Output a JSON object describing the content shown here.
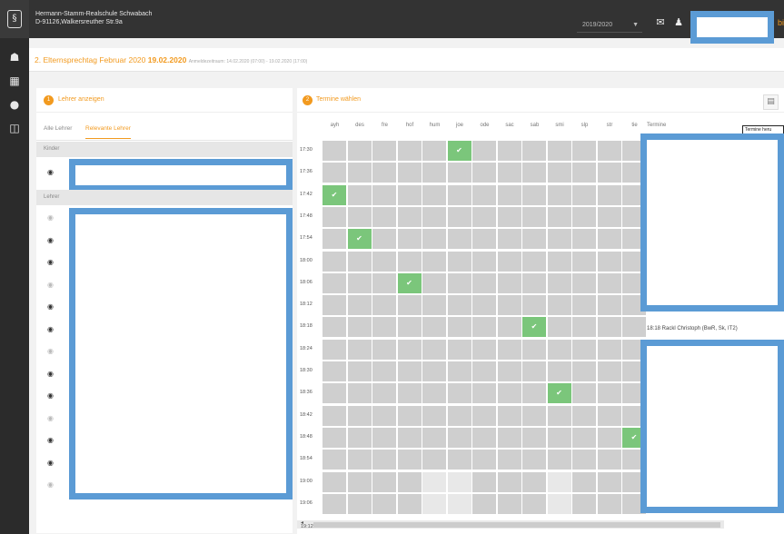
{
  "app": {
    "school_name": "Hermann-Stamm-Realschule Schwabach",
    "school_address": "D-91126,Walkersreuther Str.9a",
    "school_year": "2019/2020",
    "edge_mark": "bi"
  },
  "event": {
    "title_prefix": "2. Elternsprechtag Februar 2020",
    "title_date": "19.02.2020",
    "anmeldung": "Anmeldezeitraum: 14.02.2020 (07:00) - 19.02.2020 (17:00)"
  },
  "icons": {
    "logo": "school-logo",
    "sidebar": [
      "dashboard-icon",
      "calendar-icon",
      "chat-icon",
      "book-icon"
    ],
    "topbar": [
      "mail-icon",
      "user-icon"
    ],
    "eye": "eye-icon",
    "pdf": "pdf-icon",
    "check": "check-icon"
  },
  "left_panel": {
    "step_number": "1",
    "header": "Lehrer anzeigen",
    "tabs": [
      "Alle Lehrer",
      "Relevante Lehrer"
    ],
    "section_kinder": "Kinder",
    "section_lehrer": "Lehrer",
    "kinder_eye_count": 1,
    "lehrer_eye_count": 13
  },
  "right_panel": {
    "step_number": "2",
    "header": "Termine wählen",
    "tooltip": "Termine heru",
    "termine_label": "Termine",
    "booked_entry": "18:18 Rackl Christoph (BwR, Sk, IT2)",
    "teacher_columns": [
      "ayh",
      "des",
      "fre",
      "hof",
      "hum",
      "joe",
      "ode",
      "sac",
      "sab",
      "smi",
      "slp",
      "str",
      "tie"
    ],
    "times": [
      "17:30",
      "17:36",
      "17:42",
      "17:48",
      "17:54",
      "18:00",
      "18:06",
      "18:12",
      "18:18",
      "18:24",
      "18:30",
      "18:36",
      "18:42",
      "18:48",
      "18:54",
      "19:00",
      "19:06"
    ],
    "last_time": "19:12",
    "booked": [
      {
        "time": "17:30",
        "column": "joe"
      },
      {
        "time": "17:42",
        "column": "ayh"
      },
      {
        "time": "17:54",
        "column": "des"
      },
      {
        "time": "18:06",
        "column": "hof"
      },
      {
        "time": "18:18",
        "column": "sab"
      },
      {
        "time": "18:36",
        "column": "smi"
      },
      {
        "time": "18:48",
        "column": "tie"
      }
    ],
    "free_slots": [
      {
        "time": "19:00",
        "columns": [
          "hum",
          "joe",
          "smi"
        ]
      },
      {
        "time": "19:06",
        "columns": [
          "hum",
          "joe",
          "smi"
        ]
      }
    ],
    "check_mark": "✔"
  }
}
